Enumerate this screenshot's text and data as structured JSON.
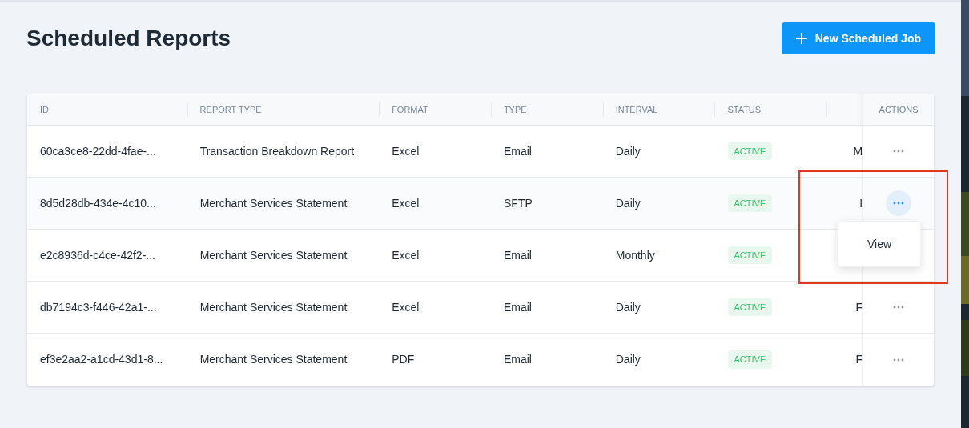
{
  "page": {
    "title": "Scheduled Reports"
  },
  "new_button": {
    "label": "New Scheduled Job"
  },
  "table": {
    "columns": [
      "ID",
      "REPORT TYPE",
      "FORMAT",
      "TYPE",
      "INTERVAL",
      "STATUS",
      "",
      "ACTIONS"
    ],
    "rows": [
      {
        "id": "60ca3ce8-22dd-4fae-...",
        "report_type": "Transaction Breakdown Report",
        "format": "Excel",
        "type": "Email",
        "interval": "Daily",
        "status": "ACTIVE",
        "column_7": "M",
        "menu_open": false
      },
      {
        "id": "8d5d28db-434e-4c10...",
        "report_type": "Merchant Services Statement",
        "format": "Excel",
        "type": "SFTP",
        "interval": "Daily",
        "status": "ACTIVE",
        "column_7": "I",
        "menu_open": true
      },
      {
        "id": "e2c8936d-c4ce-42f2-...",
        "report_type": "Merchant Services Statement",
        "format": "Excel",
        "type": "Email",
        "interval": "Monthly",
        "status": "ACTIVE",
        "menu_open": false
      },
      {
        "id": "db7194c3-f446-42a1-...",
        "report_type": "Merchant Services Statement",
        "format": "Excel",
        "type": "Email",
        "interval": "Daily",
        "status": "ACTIVE",
        "column_7": "F",
        "menu_open": false
      },
      {
        "id": "ef3e2aa2-a1cd-43d1-8...",
        "report_type": "Merchant Services Statement",
        "format": "PDF",
        "type": "Email",
        "interval": "Daily",
        "status": "ACTIVE",
        "column_7": "F",
        "menu_open": false
      }
    ]
  },
  "row_menu": {
    "items": [
      "View"
    ]
  }
}
